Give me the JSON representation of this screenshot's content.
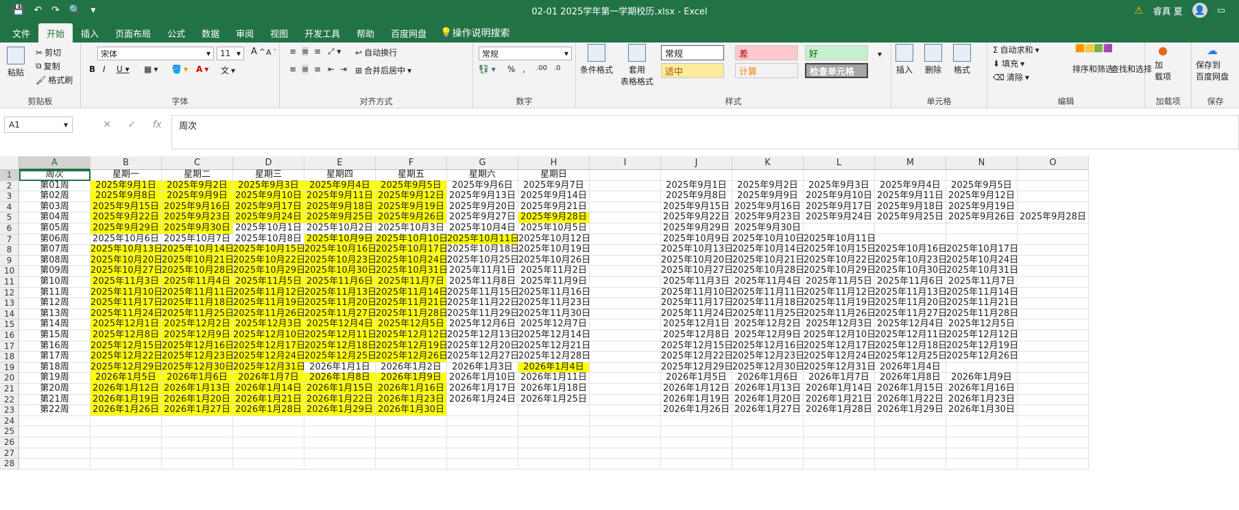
{
  "window": {
    "title": "02-01 2025学年第一学期校历.xlsx  -  Excel",
    "user": "睿真 夏"
  },
  "tabs": [
    "文件",
    "开始",
    "插入",
    "页面布局",
    "公式",
    "数据",
    "审阅",
    "视图",
    "开发工具",
    "帮助",
    "百度网盘"
  ],
  "active_tab": "开始",
  "tell_me": "操作说明搜索",
  "ribbon": {
    "clipboard": {
      "label": "剪贴板",
      "paste": "粘贴",
      "cut": "剪切",
      "copy": "复制",
      "painter": "格式刷"
    },
    "font": {
      "label": "字体",
      "name": "宋体",
      "size": "11"
    },
    "align": {
      "label": "对齐方式",
      "wrap": "自动换行",
      "merge": "合并后居中"
    },
    "number": {
      "label": "数字",
      "format": "常规"
    },
    "styles": {
      "label": "样式",
      "cond": "条件格式",
      "table": "套用\n表格格式",
      "normal": "常规",
      "bad": "差",
      "good": "好",
      "neutral": "适中",
      "calc": "计算",
      "check": "检查单元格"
    },
    "cells": {
      "label": "单元格",
      "insert": "插入",
      "delete": "删除",
      "format": "格式"
    },
    "edit": {
      "label": "编辑",
      "autosum": "自动求和",
      "fill": "填充",
      "clear": "清除",
      "sort": "排序和筛选",
      "find": "查找和选择"
    },
    "addin": {
      "label": "加载项",
      "btn": "加\n载项"
    },
    "save": {
      "label": "保存",
      "btn": "保存到\n百度网盘"
    }
  },
  "formula_bar": {
    "namebox": "A1",
    "formula": "周次"
  },
  "colors": {
    "accent": "#217346",
    "highlight": "#ffff00"
  },
  "columns": [
    "A",
    "B",
    "C",
    "D",
    "E",
    "F",
    "G",
    "H",
    "I",
    "J",
    "K",
    "L",
    "M",
    "N",
    "O"
  ],
  "rows": [
    [
      "周次",
      "星期一",
      "星期二",
      "星期三",
      "星期四",
      "星期五",
      "星期六",
      "星期日",
      "",
      "",
      "",
      "",
      "",
      "",
      ""
    ],
    [
      "第01周",
      "2025年9月1日",
      "2025年9月2日",
      "2025年9月3日",
      "2025年9月4日",
      "2025年9月5日",
      "2025年9月6日",
      "2025年9月7日",
      "",
      "2025年9月1日",
      "2025年9月2日",
      "2025年9月3日",
      "2025年9月4日",
      "2025年9月5日",
      ""
    ],
    [
      "第02周",
      "2025年9月8日",
      "2025年9月9日",
      "2025年9月10日",
      "2025年9月11日",
      "2025年9月12日",
      "2025年9月13日",
      "2025年9月14日",
      "",
      "2025年9月8日",
      "2025年9月9日",
      "2025年9月10日",
      "2025年9月11日",
      "2025年9月12日",
      ""
    ],
    [
      "第03周",
      "2025年9月15日",
      "2025年9月16日",
      "2025年9月17日",
      "2025年9月18日",
      "2025年9月19日",
      "2025年9月20日",
      "2025年9月21日",
      "",
      "2025年9月15日",
      "2025年9月16日",
      "2025年9月17日",
      "2025年9月18日",
      "2025年9月19日",
      ""
    ],
    [
      "第04周",
      "2025年9月22日",
      "2025年9月23日",
      "2025年9月24日",
      "2025年9月25日",
      "2025年9月26日",
      "2025年9月27日",
      "2025年9月28日",
      "",
      "2025年9月22日",
      "2025年9月23日",
      "2025年9月24日",
      "2025年9月25日",
      "2025年9月26日",
      "2025年9月28日"
    ],
    [
      "第05周",
      "2025年9月29日",
      "2025年9月30日",
      "2025年10月1日",
      "2025年10月2日",
      "2025年10月3日",
      "2025年10月4日",
      "2025年10月5日",
      "",
      "2025年9月29日",
      "2025年9月30日",
      "",
      "",
      "",
      ""
    ],
    [
      "第06周",
      "2025年10月6日",
      "2025年10月7日",
      "2025年10月8日",
      "2025年10月9日",
      "2025年10月10日",
      "2025年10月11日",
      "2025年10月12日",
      "",
      "2025年10月9日",
      "2025年10月10日",
      "2025年10月11日",
      "",
      "",
      ""
    ],
    [
      "第07周",
      "2025年10月13日",
      "2025年10月14日",
      "2025年10月15日",
      "2025年10月16日",
      "2025年10月17日",
      "2025年10月18日",
      "2025年10月19日",
      "",
      "2025年10月13日",
      "2025年10月14日",
      "2025年10月15日",
      "2025年10月16日",
      "2025年10月17日",
      ""
    ],
    [
      "第08周",
      "2025年10月20日",
      "2025年10月21日",
      "2025年10月22日",
      "2025年10月23日",
      "2025年10月24日",
      "2025年10月25日",
      "2025年10月26日",
      "",
      "2025年10月20日",
      "2025年10月21日",
      "2025年10月22日",
      "2025年10月23日",
      "2025年10月24日",
      ""
    ],
    [
      "第09周",
      "2025年10月27日",
      "2025年10月28日",
      "2025年10月29日",
      "2025年10月30日",
      "2025年10月31日",
      "2025年11月1日",
      "2025年11月2日",
      "",
      "2025年10月27日",
      "2025年10月28日",
      "2025年10月29日",
      "2025年10月30日",
      "2025年10月31日",
      ""
    ],
    [
      "第10周",
      "2025年11月3日",
      "2025年11月4日",
      "2025年11月5日",
      "2025年11月6日",
      "2025年11月7日",
      "2025年11月8日",
      "2025年11月9日",
      "",
      "2025年11月3日",
      "2025年11月4日",
      "2025年11月5日",
      "2025年11月6日",
      "2025年11月7日",
      ""
    ],
    [
      "第11周",
      "2025年11月10日",
      "2025年11月11日",
      "2025年11月12日",
      "2025年11月13日",
      "2025年11月14日",
      "2025年11月15日",
      "2025年11月16日",
      "",
      "2025年11月10日",
      "2025年11月11日",
      "2025年11月12日",
      "2025年11月13日",
      "2025年11月14日",
      ""
    ],
    [
      "第12周",
      "2025年11月17日",
      "2025年11月18日",
      "2025年11月19日",
      "2025年11月20日",
      "2025年11月21日",
      "2025年11月22日",
      "2025年11月23日",
      "",
      "2025年11月17日",
      "2025年11月18日",
      "2025年11月19日",
      "2025年11月20日",
      "2025年11月21日",
      ""
    ],
    [
      "第13周",
      "2025年11月24日",
      "2025年11月25日",
      "2025年11月26日",
      "2025年11月27日",
      "2025年11月28日",
      "2025年11月29日",
      "2025年11月30日",
      "",
      "2025年11月24日",
      "2025年11月25日",
      "2025年11月26日",
      "2025年11月27日",
      "2025年11月28日",
      ""
    ],
    [
      "第14周",
      "2025年12月1日",
      "2025年12月2日",
      "2025年12月3日",
      "2025年12月4日",
      "2025年12月5日",
      "2025年12月6日",
      "2025年12月7日",
      "",
      "2025年12月1日",
      "2025年12月2日",
      "2025年12月3日",
      "2025年12月4日",
      "2025年12月5日",
      ""
    ],
    [
      "第15周",
      "2025年12月8日",
      "2025年12月9日",
      "2025年12月10日",
      "2025年12月11日",
      "2025年12月12日",
      "2025年12月13日",
      "2025年12月14日",
      "",
      "2025年12月8日",
      "2025年12月9日",
      "2025年12月10日",
      "2025年12月11日",
      "2025年12月12日",
      ""
    ],
    [
      "第16周",
      "2025年12月15日",
      "2025年12月16日",
      "2025年12月17日",
      "2025年12月18日",
      "2025年12月19日",
      "2025年12月20日",
      "2025年12月21日",
      "",
      "2025年12月15日",
      "2025年12月16日",
      "2025年12月17日",
      "2025年12月18日",
      "2025年12月19日",
      ""
    ],
    [
      "第17周",
      "2025年12月22日",
      "2025年12月23日",
      "2025年12月24日",
      "2025年12月25日",
      "2025年12月26日",
      "2025年12月27日",
      "2025年12月28日",
      "",
      "2025年12月22日",
      "2025年12月23日",
      "2025年12月24日",
      "2025年12月25日",
      "2025年12月26日",
      ""
    ],
    [
      "第18周",
      "2025年12月29日",
      "2025年12月30日",
      "2025年12月31日",
      "2026年1月1日",
      "2026年1月2日",
      "2026年1月3日",
      "2026年1月4日",
      "",
      "2025年12月29日",
      "2025年12月30日",
      "2025年12月31日",
      "2026年1月4日",
      "",
      ""
    ],
    [
      "第19周",
      "2026年1月5日",
      "2026年1月6日",
      "2026年1月7日",
      "2026年1月8日",
      "2026年1月9日",
      "2026年1月10日",
      "2026年1月11日",
      "",
      "2026年1月5日",
      "2026年1月6日",
      "2026年1月7日",
      "2026年1月8日",
      "2026年1月9日",
      ""
    ],
    [
      "第20周",
      "2026年1月12日",
      "2026年1月13日",
      "2026年1月14日",
      "2026年1月15日",
      "2026年1月16日",
      "2026年1月17日",
      "2026年1月18日",
      "",
      "2026年1月12日",
      "2026年1月13日",
      "2026年1月14日",
      "2026年1月15日",
      "2026年1月16日",
      ""
    ],
    [
      "第21周",
      "2026年1月19日",
      "2026年1月20日",
      "2026年1月21日",
      "2026年1月22日",
      "2026年1月23日",
      "2026年1月24日",
      "2026年1月25日",
      "",
      "2026年1月19日",
      "2026年1月20日",
      "2026年1月21日",
      "2026年1月22日",
      "2026年1月23日",
      ""
    ],
    [
      "第22周",
      "2026年1月26日",
      "2026年1月27日",
      "2026年1月28日",
      "2026年1月29日",
      "2026年1月30日",
      "",
      "",
      "",
      "2026年1月26日",
      "2026年1月27日",
      "2026年1月28日",
      "2026年1月29日",
      "2026年1月30日",
      ""
    ],
    [
      "",
      "",
      "",
      "",
      "",
      "",
      "",
      "",
      "",
      "",
      "",
      "",
      "",
      "",
      ""
    ],
    [
      "",
      "",
      "",
      "",
      "",
      "",
      "",
      "",
      "",
      "",
      "",
      "",
      "",
      "",
      ""
    ],
    [
      "",
      "",
      "",
      "",
      "",
      "",
      "",
      "",
      "",
      "",
      "",
      "",
      "",
      "",
      ""
    ],
    [
      "",
      "",
      "",
      "",
      "",
      "",
      "",
      "",
      "",
      "",
      "",
      "",
      "",
      "",
      ""
    ],
    [
      "",
      "",
      "",
      "",
      "",
      "",
      "",
      "",
      "",
      "",
      "",
      "",
      "",
      "",
      ""
    ]
  ],
  "highlighted": [
    "B2",
    "C2",
    "D2",
    "E2",
    "F2",
    "B3",
    "C3",
    "D3",
    "E3",
    "F3",
    "B4",
    "C4",
    "D4",
    "E4",
    "F4",
    "B5",
    "C5",
    "D5",
    "E5",
    "F5",
    "H5",
    "B6",
    "C6",
    "E7",
    "F7",
    "G7",
    "B8",
    "C8",
    "D8",
    "E8",
    "F8",
    "B9",
    "C9",
    "D9",
    "E9",
    "F9",
    "B10",
    "C10",
    "D10",
    "E10",
    "F10",
    "B11",
    "C11",
    "D11",
    "E11",
    "F11",
    "B12",
    "C12",
    "D12",
    "E12",
    "F12",
    "B13",
    "C13",
    "D13",
    "E13",
    "F13",
    "B14",
    "C14",
    "D14",
    "E14",
    "F14",
    "B15",
    "C15",
    "D15",
    "E15",
    "F15",
    "B16",
    "C16",
    "D16",
    "E16",
    "F16",
    "B17",
    "C17",
    "D17",
    "E17",
    "F17",
    "B18",
    "C18",
    "D18",
    "E18",
    "F18",
    "B19",
    "C19",
    "D19",
    "H19",
    "B20",
    "C20",
    "D20",
    "E20",
    "F20",
    "B21",
    "C21",
    "D21",
    "E21",
    "F21",
    "B22",
    "C22",
    "D22",
    "E22",
    "F22",
    "B23",
    "C23",
    "D23",
    "E23",
    "F23"
  ]
}
